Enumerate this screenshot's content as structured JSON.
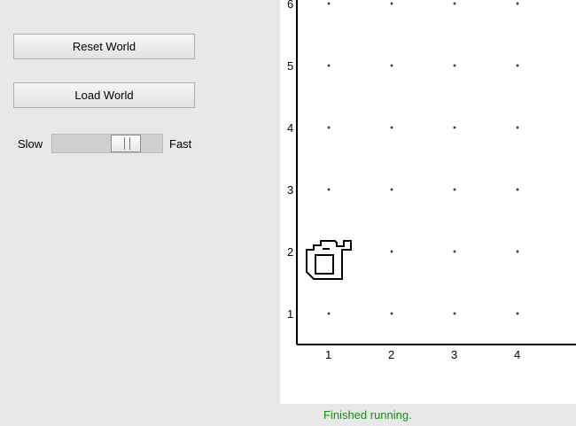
{
  "controls": {
    "reset_label": "Reset World",
    "load_label": "Load World",
    "slow_label": "Slow",
    "fast_label": "Fast",
    "speed_level_fraction": 0.62
  },
  "world": {
    "row_labels": [
      "1",
      "2",
      "3",
      "4",
      "5",
      "6"
    ],
    "col_labels": [
      "1",
      "2",
      "3",
      "4"
    ],
    "robot_position": {
      "avenue": 1,
      "street": 2
    },
    "robot_facing": "north",
    "robot_icon": "karel-robot-icon",
    "corner_marker": "dot"
  },
  "status": {
    "text": "Finished running.",
    "color": "#1a8a1a"
  }
}
